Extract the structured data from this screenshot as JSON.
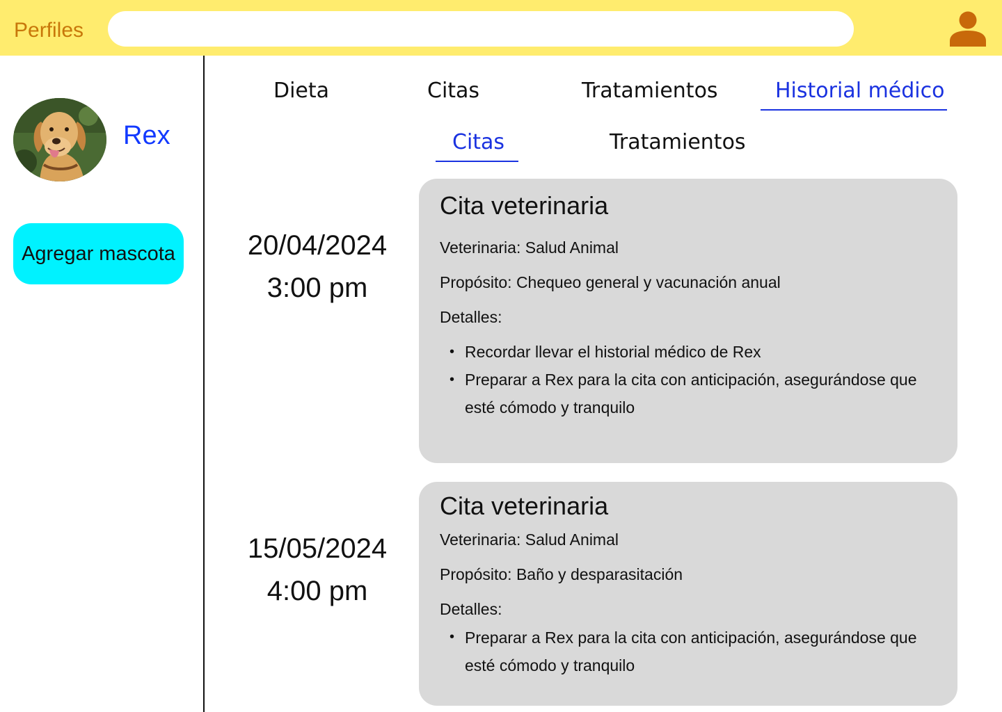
{
  "header": {
    "brand": "Perfiles",
    "search_placeholder": ""
  },
  "sidebar": {
    "pet_name": "Rex",
    "add_button_label": "Agregar mascota"
  },
  "tabs": {
    "main": [
      {
        "label": "Dieta"
      },
      {
        "label": "Citas"
      },
      {
        "label": "Tratamientos"
      },
      {
        "label": "Historial médico"
      }
    ],
    "sub": [
      {
        "label": "Citas"
      },
      {
        "label": "Tratamientos"
      }
    ],
    "active_main": "Historial médico",
    "active_sub": "Citas"
  },
  "appointments": [
    {
      "date": "20/04/2024",
      "time": "3:00 pm",
      "title": "Cita veterinaria",
      "vet": "Veterinaria: Salud Animal",
      "purpose": "Propósito: Chequeo general y vacunación anual",
      "details_label": "Detalles:",
      "details": [
        "Recordar llevar el historial médico de Rex",
        "Preparar a Rex para la cita con anticipación, asegurándose que esté cómodo y tranquilo"
      ]
    },
    {
      "date": "15/05/2024",
      "time": "4:00 pm",
      "title": "Cita veterinaria",
      "vet": "Veterinaria: Salud Animal",
      "purpose": "Propósito: Baño y desparasitación",
      "details_label": "Detalles:",
      "details": [
        "Preparar a Rex para la cita con anticipación, asegurándose que esté cómodo y tranquilo"
      ]
    }
  ],
  "colors": {
    "header_bg": "#ffec6e",
    "brand": "#c8770a",
    "accent_blue": "#1a32e0",
    "add_button": "#00f2ff",
    "card_bg": "#d9d9d9"
  },
  "icons": {
    "user": "user-icon"
  }
}
